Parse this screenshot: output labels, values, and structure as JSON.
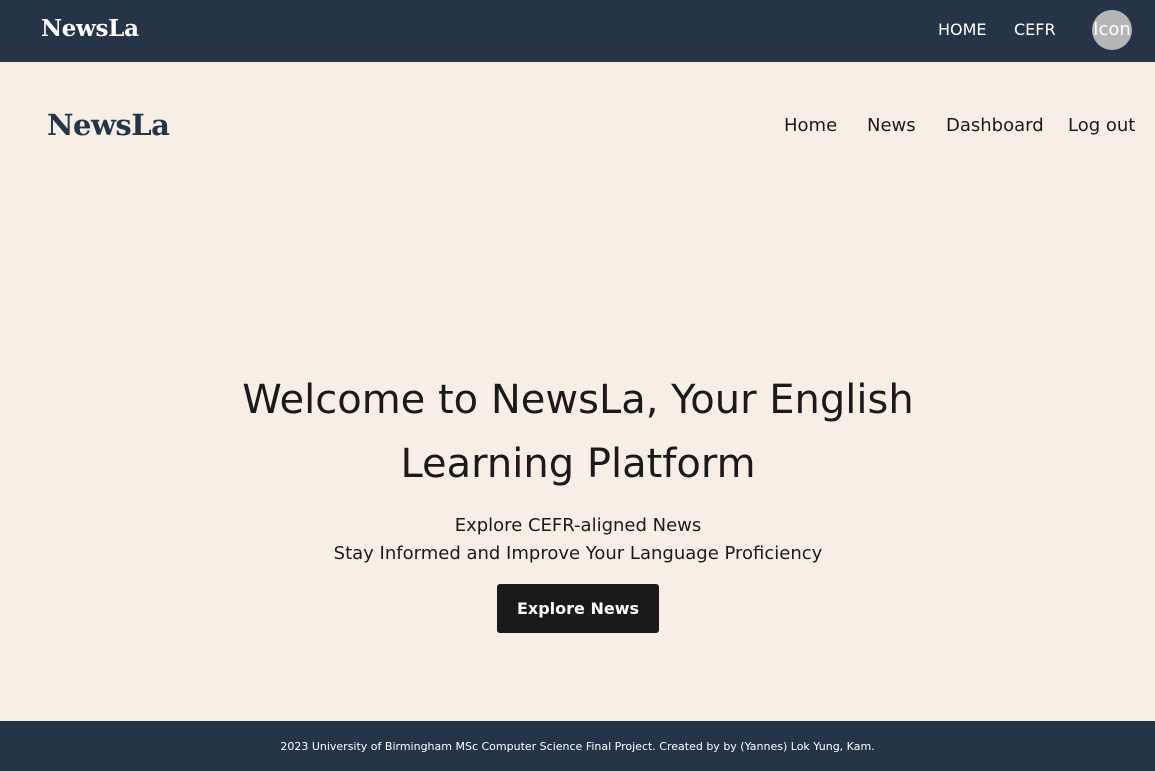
{
  "topbar": {
    "brand": "NewsLa",
    "nav": {
      "home": "HOME",
      "cefr": "CEFR"
    },
    "avatar_label": "Icon"
  },
  "header": {
    "brand": "NewsLa",
    "nav": {
      "home": "Home",
      "news": "News",
      "dashboard": "Dashboard",
      "logout": "Log out"
    }
  },
  "hero": {
    "title": "Welcome to NewsLa, Your English Learning Platform",
    "subtitle_line1": "Explore CEFR-aligned News",
    "subtitle_line2": "Stay Informed and Improve Your Language Proficiency",
    "cta_label": "Explore News"
  },
  "footer": {
    "text": "2023 University of Birmingham MSc Computer Science Final Project. Created by by (Yannes) Lok Yung, Kam."
  },
  "colors": {
    "navbar_bg": "#253447",
    "page_bg": "#f7efe6",
    "button_bg": "#1a1a1a",
    "avatar_bg": "#b5b5b5"
  }
}
